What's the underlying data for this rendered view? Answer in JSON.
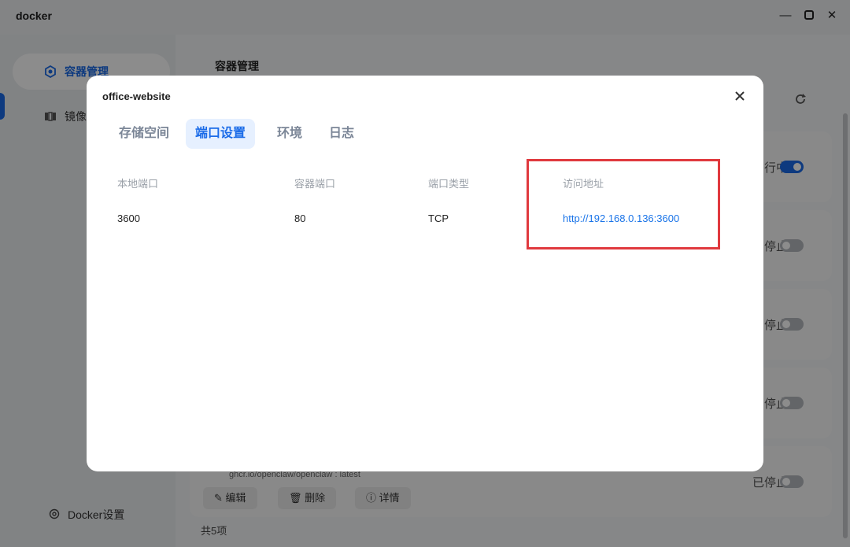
{
  "window": {
    "title": "docker"
  },
  "sidebar": {
    "items": [
      {
        "label": "容器管理",
        "icon": "container-icon"
      },
      {
        "label": "镜像",
        "icon": "image-icon"
      }
    ],
    "settings_label": "Docker设置"
  },
  "main": {
    "title": "容器管理",
    "containers": [
      {
        "status": "行中"
      },
      {
        "status": "停止"
      },
      {
        "status": "停止"
      },
      {
        "status": "停止"
      },
      {
        "status": "已停止",
        "image": "ghcr.io/openclaw/openclaw :  latest"
      }
    ],
    "buttons": {
      "edit": "编辑",
      "delete": "删除",
      "details": "详情"
    },
    "count": "共5项"
  },
  "modal": {
    "title": "office-website",
    "tabs": [
      "存储空间",
      "端口设置",
      "环境",
      "日志"
    ],
    "active_tab": "端口设置",
    "columns": [
      "本地端口",
      "容器端口",
      "端口类型",
      "访问地址"
    ],
    "rows": [
      {
        "local_port": "3600",
        "container_port": "80",
        "type": "TCP",
        "url": "http://192.168.0.136:3600"
      }
    ]
  },
  "colors": {
    "accent": "#1a6be8",
    "highlight_box": "#e0393e"
  }
}
